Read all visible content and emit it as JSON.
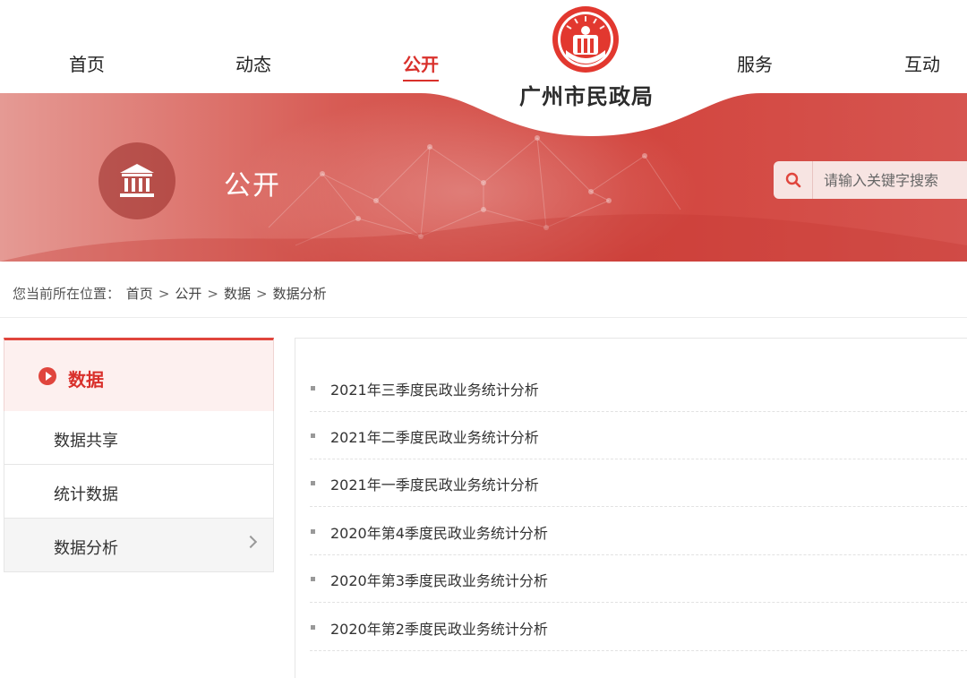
{
  "nav": {
    "items": [
      {
        "label": "首页",
        "active": false
      },
      {
        "label": "动态",
        "active": false
      },
      {
        "label": "公开",
        "active": true
      },
      {
        "label": "服务",
        "active": false
      },
      {
        "label": "互动",
        "active": false
      }
    ]
  },
  "logo": {
    "text": "广州市民政局",
    "primary_color": "#e2382f"
  },
  "banner": {
    "title": "公开",
    "icon": "institution-building-icon",
    "search": {
      "placeholder": "请输入关键字搜索",
      "icon": "search-icon"
    }
  },
  "breadcrumb": {
    "prefix": "您当前所在位置：",
    "items": [
      "首页",
      "公开",
      "数据",
      "数据分析"
    ],
    "separator": ">"
  },
  "sidebar": {
    "heading": "数据",
    "items": [
      {
        "label": "数据共享"
      },
      {
        "label": "统计数据"
      },
      {
        "label": "数据分析",
        "selected": true
      }
    ]
  },
  "articles": [
    "2021年三季度民政业务统计分析",
    "2021年二季度民政业务统计分析",
    "2021年一季度民政业务统计分析",
    "2020年第4季度民政业务统计分析",
    "2020年第3季度民政业务统计分析",
    "2020年第2季度民政业务统计分析"
  ],
  "colors": {
    "accent": "#d9302b",
    "banner": "#d2453e"
  }
}
